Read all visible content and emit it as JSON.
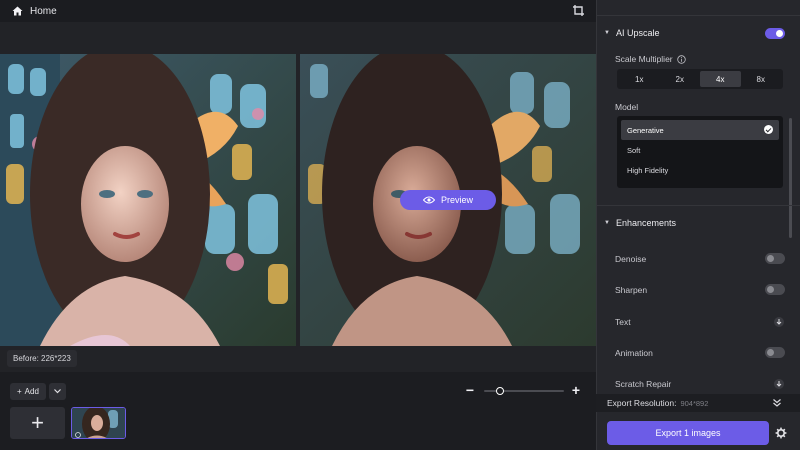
{
  "topbar": {
    "home_label": "Home"
  },
  "canvas": {
    "preview_label": "Preview",
    "before_label": "Before: 226*223"
  },
  "bottom": {
    "add_label": "Add",
    "add_tile_symbol": "+",
    "zoom_level": 0.2
  },
  "panel": {
    "ai_upscale": {
      "title": "AI Upscale",
      "enabled": true
    },
    "scale_multiplier": {
      "label": "Scale Multiplier",
      "options": [
        "1x",
        "2x",
        "4x",
        "8x"
      ],
      "selected": "4x"
    },
    "model": {
      "label": "Model",
      "options": [
        "Generative",
        "Soft",
        "High Fidelity"
      ],
      "selected": "Generative"
    },
    "enhancements": {
      "title": "Enhancements",
      "items": [
        {
          "label": "Denoise",
          "control": "toggle",
          "enabled": false
        },
        {
          "label": "Sharpen",
          "control": "toggle",
          "enabled": false
        },
        {
          "label": "Text",
          "control": "download-icon"
        },
        {
          "label": "Animation",
          "control": "toggle",
          "enabled": false
        },
        {
          "label": "Scratch Repair",
          "control": "download-icon"
        }
      ]
    },
    "export_resolution": {
      "label": "Export Resolution:",
      "value": "904*892"
    },
    "export_button": "Export 1 images"
  },
  "colors": {
    "accent": "#6c5ce7",
    "panel_bg": "#26272c",
    "canvas_bg": "#222327"
  }
}
